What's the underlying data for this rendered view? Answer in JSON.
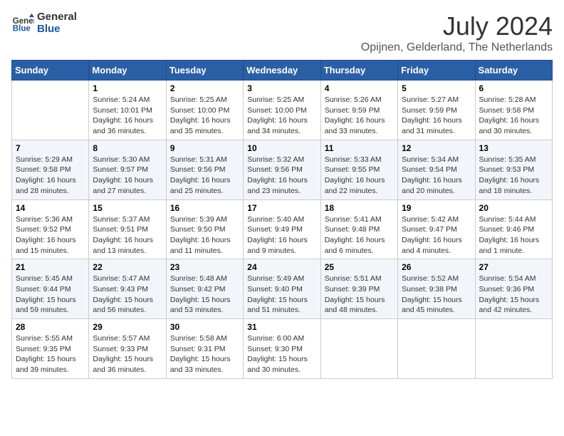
{
  "logo": {
    "line1": "General",
    "line2": "Blue"
  },
  "title": "July 2024",
  "location": "Opijnen, Gelderland, The Netherlands",
  "days_of_week": [
    "Sunday",
    "Monday",
    "Tuesday",
    "Wednesday",
    "Thursday",
    "Friday",
    "Saturday"
  ],
  "weeks": [
    [
      {
        "day": "",
        "info": ""
      },
      {
        "day": "1",
        "info": "Sunrise: 5:24 AM\nSunset: 10:01 PM\nDaylight: 16 hours\nand 36 minutes."
      },
      {
        "day": "2",
        "info": "Sunrise: 5:25 AM\nSunset: 10:00 PM\nDaylight: 16 hours\nand 35 minutes."
      },
      {
        "day": "3",
        "info": "Sunrise: 5:25 AM\nSunset: 10:00 PM\nDaylight: 16 hours\nand 34 minutes."
      },
      {
        "day": "4",
        "info": "Sunrise: 5:26 AM\nSunset: 9:59 PM\nDaylight: 16 hours\nand 33 minutes."
      },
      {
        "day": "5",
        "info": "Sunrise: 5:27 AM\nSunset: 9:59 PM\nDaylight: 16 hours\nand 31 minutes."
      },
      {
        "day": "6",
        "info": "Sunrise: 5:28 AM\nSunset: 9:58 PM\nDaylight: 16 hours\nand 30 minutes."
      }
    ],
    [
      {
        "day": "7",
        "info": "Sunrise: 5:29 AM\nSunset: 9:58 PM\nDaylight: 16 hours\nand 28 minutes."
      },
      {
        "day": "8",
        "info": "Sunrise: 5:30 AM\nSunset: 9:57 PM\nDaylight: 16 hours\nand 27 minutes."
      },
      {
        "day": "9",
        "info": "Sunrise: 5:31 AM\nSunset: 9:56 PM\nDaylight: 16 hours\nand 25 minutes."
      },
      {
        "day": "10",
        "info": "Sunrise: 5:32 AM\nSunset: 9:56 PM\nDaylight: 16 hours\nand 23 minutes."
      },
      {
        "day": "11",
        "info": "Sunrise: 5:33 AM\nSunset: 9:55 PM\nDaylight: 16 hours\nand 22 minutes."
      },
      {
        "day": "12",
        "info": "Sunrise: 5:34 AM\nSunset: 9:54 PM\nDaylight: 16 hours\nand 20 minutes."
      },
      {
        "day": "13",
        "info": "Sunrise: 5:35 AM\nSunset: 9:53 PM\nDaylight: 16 hours\nand 18 minutes."
      }
    ],
    [
      {
        "day": "14",
        "info": "Sunrise: 5:36 AM\nSunset: 9:52 PM\nDaylight: 16 hours\nand 15 minutes."
      },
      {
        "day": "15",
        "info": "Sunrise: 5:37 AM\nSunset: 9:51 PM\nDaylight: 16 hours\nand 13 minutes."
      },
      {
        "day": "16",
        "info": "Sunrise: 5:39 AM\nSunset: 9:50 PM\nDaylight: 16 hours\nand 11 minutes."
      },
      {
        "day": "17",
        "info": "Sunrise: 5:40 AM\nSunset: 9:49 PM\nDaylight: 16 hours\nand 9 minutes."
      },
      {
        "day": "18",
        "info": "Sunrise: 5:41 AM\nSunset: 9:48 PM\nDaylight: 16 hours\nand 6 minutes."
      },
      {
        "day": "19",
        "info": "Sunrise: 5:42 AM\nSunset: 9:47 PM\nDaylight: 16 hours\nand 4 minutes."
      },
      {
        "day": "20",
        "info": "Sunrise: 5:44 AM\nSunset: 9:46 PM\nDaylight: 16 hours\nand 1 minute."
      }
    ],
    [
      {
        "day": "21",
        "info": "Sunrise: 5:45 AM\nSunset: 9:44 PM\nDaylight: 15 hours\nand 59 minutes."
      },
      {
        "day": "22",
        "info": "Sunrise: 5:47 AM\nSunset: 9:43 PM\nDaylight: 15 hours\nand 56 minutes."
      },
      {
        "day": "23",
        "info": "Sunrise: 5:48 AM\nSunset: 9:42 PM\nDaylight: 15 hours\nand 53 minutes."
      },
      {
        "day": "24",
        "info": "Sunrise: 5:49 AM\nSunset: 9:40 PM\nDaylight: 15 hours\nand 51 minutes."
      },
      {
        "day": "25",
        "info": "Sunrise: 5:51 AM\nSunset: 9:39 PM\nDaylight: 15 hours\nand 48 minutes."
      },
      {
        "day": "26",
        "info": "Sunrise: 5:52 AM\nSunset: 9:38 PM\nDaylight: 15 hours\nand 45 minutes."
      },
      {
        "day": "27",
        "info": "Sunrise: 5:54 AM\nSunset: 9:36 PM\nDaylight: 15 hours\nand 42 minutes."
      }
    ],
    [
      {
        "day": "28",
        "info": "Sunrise: 5:55 AM\nSunset: 9:35 PM\nDaylight: 15 hours\nand 39 minutes."
      },
      {
        "day": "29",
        "info": "Sunrise: 5:57 AM\nSunset: 9:33 PM\nDaylight: 15 hours\nand 36 minutes."
      },
      {
        "day": "30",
        "info": "Sunrise: 5:58 AM\nSunset: 9:31 PM\nDaylight: 15 hours\nand 33 minutes."
      },
      {
        "day": "31",
        "info": "Sunrise: 6:00 AM\nSunset: 9:30 PM\nDaylight: 15 hours\nand 30 minutes."
      },
      {
        "day": "",
        "info": ""
      },
      {
        "day": "",
        "info": ""
      },
      {
        "day": "",
        "info": ""
      }
    ]
  ]
}
